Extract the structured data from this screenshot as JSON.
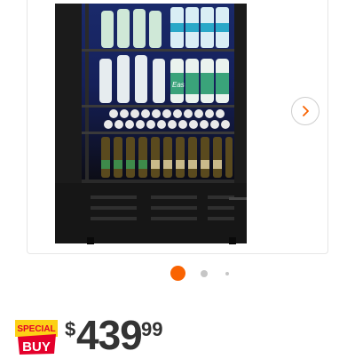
{
  "product": {
    "image_icon": "beverage-refrigerator-image",
    "bottle_brand_text": "Eas"
  },
  "gallery": {
    "next_icon": "chevron-right-icon",
    "dots": [
      {
        "state": "active"
      },
      {
        "state": "inactive"
      },
      {
        "state": "inactive"
      }
    ]
  },
  "badge": {
    "line1": "SPECIAL",
    "line2": "BUY"
  },
  "price": {
    "currency": "$",
    "dollars": "439",
    "cents": "99"
  },
  "colors": {
    "accent": "#f96302",
    "badge_yellow": "#fcd116",
    "badge_red": "#e4002b",
    "price_text": "#333333",
    "dot_inactive": "#c6c6c6"
  }
}
